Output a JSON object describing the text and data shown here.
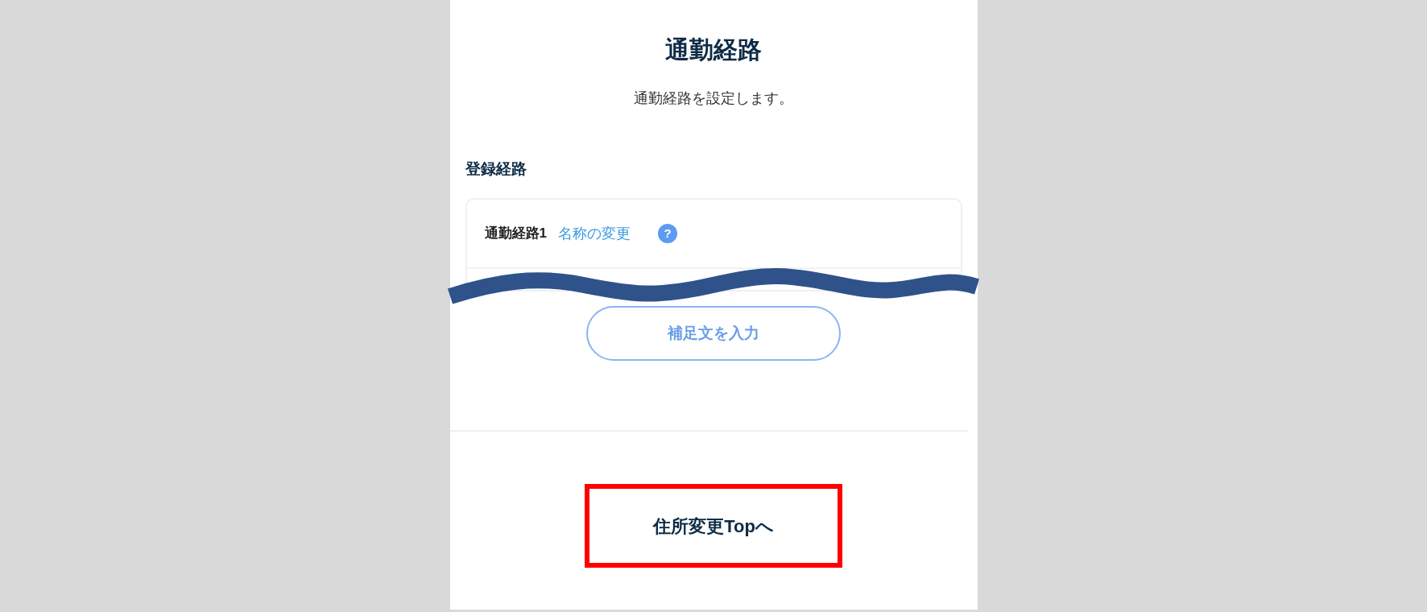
{
  "page": {
    "title": "通勤経路",
    "description": "通勤経路を設定します。"
  },
  "section": {
    "heading": "登録経路",
    "route": {
      "name": "通勤経路1",
      "rename_link": "名称の変更",
      "help_icon": "?"
    },
    "supplement_button": "補足文を入力"
  },
  "footer": {
    "top_link": "住所変更Topへ"
  }
}
